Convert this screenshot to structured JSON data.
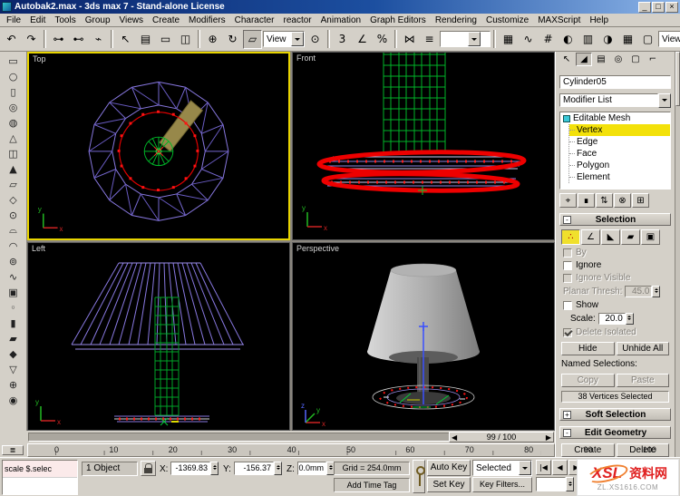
{
  "titlebar": {
    "title": "Autobak2.max - 3ds max 7 - Stand-alone License"
  },
  "menu": {
    "items": [
      "File",
      "Edit",
      "Tools",
      "Group",
      "Views",
      "Create",
      "Modifiers",
      "Character",
      "reactor",
      "Animation",
      "Graph Editors",
      "Rendering",
      "Customize",
      "MAXScript",
      "Help"
    ]
  },
  "toolbar": {
    "ref_coord": "View",
    "right_view": "View",
    "named_selection": ""
  },
  "viewports": {
    "top": "Top",
    "front": "Front",
    "left": "Left",
    "perspective": "Perspective"
  },
  "axes": {
    "x": "x",
    "y": "y",
    "z": "z"
  },
  "panel": {
    "object_name": "Cylinder05",
    "modifier_list": "Modifier List",
    "stack_root": "Editable Mesh",
    "stack_items": [
      "Vertex",
      "Edge",
      "Face",
      "Polygon",
      "Element"
    ],
    "selection_title": "Selection",
    "by_label": "By",
    "ignore_label": "Ignore",
    "ignore_visible_label": "Ignore Visible",
    "planar_label": "Planar Thresh:",
    "planar_value": "45.0",
    "show_label": "Show",
    "scale_label": "Scale:",
    "scale_value": "20.0",
    "delete_isolated_label": "Delete Isolated",
    "hide_btn": "Hide",
    "unhide_btn": "Unhide All",
    "named_selections_label": "Named Selections:",
    "copy_btn": "Copy",
    "paste_btn": "Paste",
    "selection_status": "38 Vertices Selected",
    "soft_selection_title": "Soft Selection",
    "edit_geometry_title": "Edit Geometry",
    "create_btn": "Create",
    "delete_btn": "Delete"
  },
  "timeline": {
    "frame_indicator": "99 / 100",
    "ticks": [
      "0",
      "10",
      "20",
      "30",
      "40",
      "50",
      "60",
      "70",
      "80",
      "90",
      "100"
    ]
  },
  "status": {
    "listener_line": "scale $.selec",
    "object_count": "1 Object",
    "x_label": "X:",
    "x_value": "-1369.83",
    "y_label": "Y:",
    "y_value": "-156.37",
    "z_label": "Z:",
    "z_value": "0.0mm",
    "grid_label": "Grid = 254.0mm",
    "add_time_tag": "Add Time Tag",
    "auto_key": "Auto Key",
    "set_key": "Set Key",
    "selected_dropdown": "Selected",
    "key_filters": "Key Filters..."
  },
  "watermark": {
    "logo": "XSL",
    "site_name": "资料网",
    "site_url": "ZL.XS1616.COM"
  },
  "icons": {
    "minimize": "_",
    "maximize": "□",
    "close": "×",
    "undo": "↶",
    "redo": "↷",
    "link": "⊶",
    "unlink": "⊷",
    "bind": "⌁",
    "select": "↖",
    "select_by_name": "▤",
    "region": "▭",
    "crossing": "◫",
    "move": "⊕",
    "rotate": "↻",
    "scale": "▱",
    "use_center": "⊙",
    "snap3": "3",
    "snap_angle": "∠",
    "snap_percent": "%",
    "mirror": "⋈",
    "align": "≡",
    "layers": "▦",
    "curve": "∿",
    "schematic": "#",
    "material": "◐",
    "render": "▥",
    "quick_render": "◑",
    "create_tab": "↖",
    "modify_tab": "◢",
    "hierarchy_tab": "▤",
    "motion_tab": "◎",
    "display_tab": "▢",
    "utilities_tab": "⌐",
    "pin": "⌖",
    "show_end": "∎",
    "unique": "⇅",
    "remove_mod": "⊗",
    "configure": "⊞",
    "vertex": "∴",
    "edge": "∠",
    "face": "◣",
    "polygon": "▰",
    "element": "▣",
    "minus": "-",
    "plus": "+",
    "mini_curve": "≣",
    "prev_end": "|◀",
    "prev": "◀",
    "play": "▶",
    "next_end": "▶|",
    "left_tools": [
      "▭",
      "○",
      "▯",
      "◎",
      "◍",
      "△",
      "◫",
      "▲",
      "▱",
      "◇",
      "⊙",
      "⌓",
      "◠",
      "⊚",
      "∿",
      "▣",
      "◦",
      "▮",
      "▰",
      "◆",
      "▽",
      "⊕",
      "◉"
    ]
  }
}
